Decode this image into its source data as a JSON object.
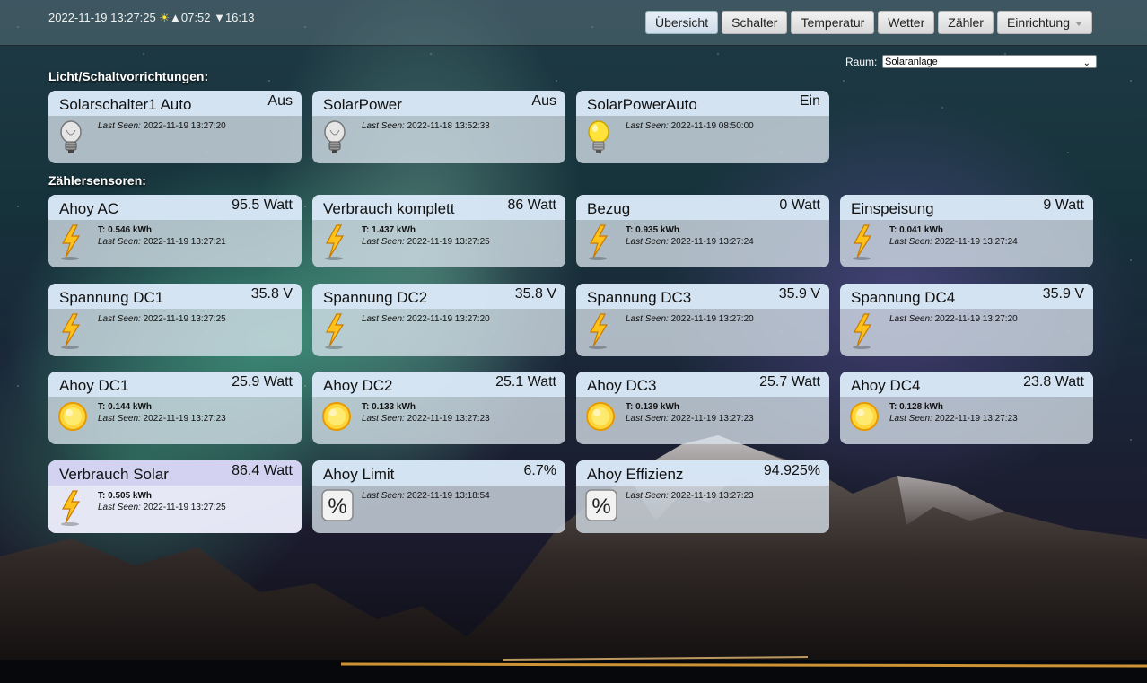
{
  "header": {
    "date": "2022-11-19 13:27:25",
    "sunrise": "07:52",
    "sunset": "16:13",
    "nav": [
      "Übersicht",
      "Schalter",
      "Temperatur",
      "Wetter",
      "Zähler",
      "Einrichtung"
    ]
  },
  "room": {
    "label": "Raum:",
    "selected": "Solaranlage"
  },
  "sections": {
    "switches": "Licht/Schaltvorrichtungen:",
    "meters": "Zählersensoren:"
  },
  "switches": [
    {
      "name": "Solarschalter1 Auto",
      "value": "Aus",
      "last_seen": "2022-11-19 13:27:20",
      "icon": "bulb-off-icon"
    },
    {
      "name": "SolarPower",
      "value": "Aus",
      "last_seen": "2022-11-18 13:52:33",
      "icon": "bulb-off-icon"
    },
    {
      "name": "SolarPowerAuto",
      "value": "Ein",
      "last_seen": "2022-11-19 08:50:00",
      "icon": "bulb-on-icon"
    }
  ],
  "meters": [
    {
      "name": "Ahoy AC",
      "value": "95.5 Watt",
      "total": "T: 0.546 kWh",
      "last_seen": "2022-11-19 13:27:21",
      "icon": "lightning-icon"
    },
    {
      "name": "Verbrauch komplett",
      "value": "86 Watt",
      "total": "T: 1.437 kWh",
      "last_seen": "2022-11-19 13:27:25",
      "icon": "lightning-icon"
    },
    {
      "name": "Bezug",
      "value": "0 Watt",
      "total": "T: 0.935 kWh",
      "last_seen": "2022-11-19 13:27:24",
      "icon": "lightning-icon"
    },
    {
      "name": "Einspeisung",
      "value": "9 Watt",
      "total": "T: 0.041 kWh",
      "last_seen": "2022-11-19 13:27:24",
      "icon": "lightning-icon"
    },
    {
      "name": "Spannung DC1",
      "value": "35.8 V",
      "total": "",
      "last_seen": "2022-11-19 13:27:25",
      "icon": "lightning-icon"
    },
    {
      "name": "Spannung DC2",
      "value": "35.8 V",
      "total": "",
      "last_seen": "2022-11-19 13:27:20",
      "icon": "lightning-icon"
    },
    {
      "name": "Spannung DC3",
      "value": "35.9 V",
      "total": "",
      "last_seen": "2022-11-19 13:27:20",
      "icon": "lightning-icon"
    },
    {
      "name": "Spannung DC4",
      "value": "35.9 V",
      "total": "",
      "last_seen": "2022-11-19 13:27:20",
      "icon": "lightning-icon"
    },
    {
      "name": "Ahoy DC1",
      "value": "25.9 Watt",
      "total": "T: 0.144 kWh",
      "last_seen": "2022-11-19 13:27:23",
      "icon": "sun-icon"
    },
    {
      "name": "Ahoy DC2",
      "value": "25.1 Watt",
      "total": "T: 0.133 kWh",
      "last_seen": "2022-11-19 13:27:23",
      "icon": "sun-icon"
    },
    {
      "name": "Ahoy DC3",
      "value": "25.7 Watt",
      "total": "T: 0.139 kWh",
      "last_seen": "2022-11-19 13:27:23",
      "icon": "sun-icon"
    },
    {
      "name": "Ahoy DC4",
      "value": "23.8 Watt",
      "total": "T: 0.128 kWh",
      "last_seen": "2022-11-19 13:27:23",
      "icon": "sun-icon"
    },
    {
      "name": "Verbrauch Solar",
      "value": "86.4 Watt",
      "total": "T: 0.505 kWh",
      "last_seen": "2022-11-19 13:27:25",
      "icon": "lightning-icon"
    },
    {
      "name": "Ahoy Limit",
      "value": "6.7%",
      "total": "",
      "last_seen": "2022-11-19 13:18:54",
      "icon": "percent-icon"
    },
    {
      "name": "Ahoy Effizienz",
      "value": "94.925%",
      "total": "",
      "last_seen": "2022-11-19 13:27:23",
      "icon": "percent-icon"
    }
  ],
  "last_seen_label": "Last Seen:",
  "colors": {
    "tile_header": "#d7e6f5",
    "highlight_header": "#d2d2f0",
    "bulb_on": "#ffe23a"
  }
}
